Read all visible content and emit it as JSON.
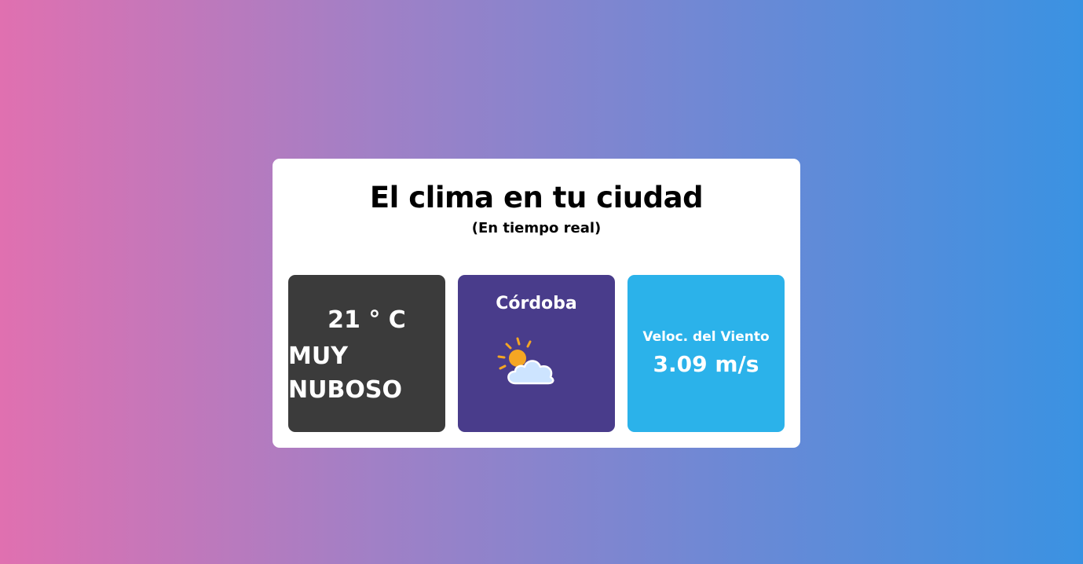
{
  "header": {
    "title": "El clima en tu ciudad",
    "subtitle": "(En tiempo real)"
  },
  "temperature": {
    "value": "21 ° C",
    "description": "MUY NUBOSO"
  },
  "location": {
    "city": "Córdoba",
    "icon": "partly-cloudy-icon"
  },
  "wind": {
    "label": "Veloc. del Viento",
    "value": "3.09 m/s"
  },
  "colors": {
    "temperature_tile": "#3b3b3b",
    "city_tile": "#493c8b",
    "wind_tile": "#2bb2ea",
    "sun": "#f5a623",
    "cloud": "#cde4ff"
  }
}
